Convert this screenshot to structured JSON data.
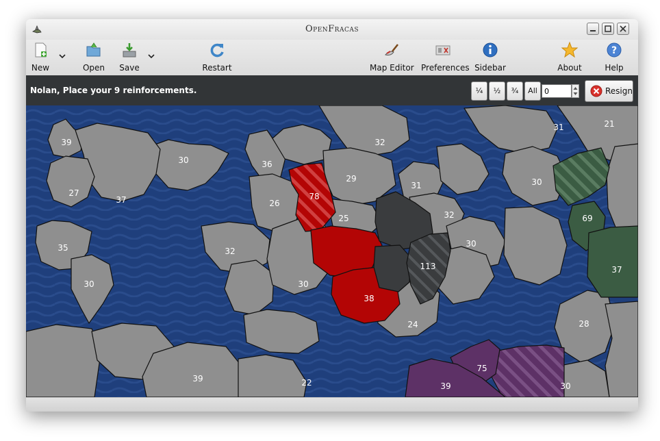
{
  "window": {
    "title": "OpenFracas"
  },
  "toolbar": {
    "new_label": "New",
    "open_label": "Open",
    "save_label": "Save",
    "restart_label": "Restart",
    "map_editor_label": "Map Editor",
    "preferences_label": "Preferences",
    "sidebar_label": "Sidebar",
    "about_label": "About",
    "help_label": "Help"
  },
  "status": {
    "message": "Nolan, Place your 9 reinforcements.",
    "fractions": [
      "¼",
      "½",
      "¾",
      "All"
    ],
    "amount_value": "0",
    "resign_label": "Resign"
  },
  "colors": {
    "sea": "#1f3f7c",
    "neutral": "#8f8f8f",
    "red": "#b00000",
    "dark": "#3a3c3e",
    "green": "#3b5c43",
    "purple": "#5d3166"
  },
  "map": {
    "armies": {
      "t39a": "39",
      "t30a": "30",
      "t27": "27",
      "t37a": "37",
      "t36": "36",
      "t26": "26",
      "t78": "78",
      "t32a": "32",
      "t29": "29",
      "t31a": "31",
      "t21": "21",
      "t30b": "30",
      "t69": "69",
      "t37b": "37",
      "t35": "35",
      "t30c": "30",
      "t32b": "32",
      "t25": "25",
      "t31b": "31",
      "t32c": "32",
      "t30d": "30",
      "t113": "113",
      "t30e": "30",
      "t38": "38",
      "t24": "24",
      "t28": "28",
      "t39b": "39",
      "t22": "22",
      "t75": "75",
      "t39c": "39",
      "t30f": "30"
    }
  }
}
